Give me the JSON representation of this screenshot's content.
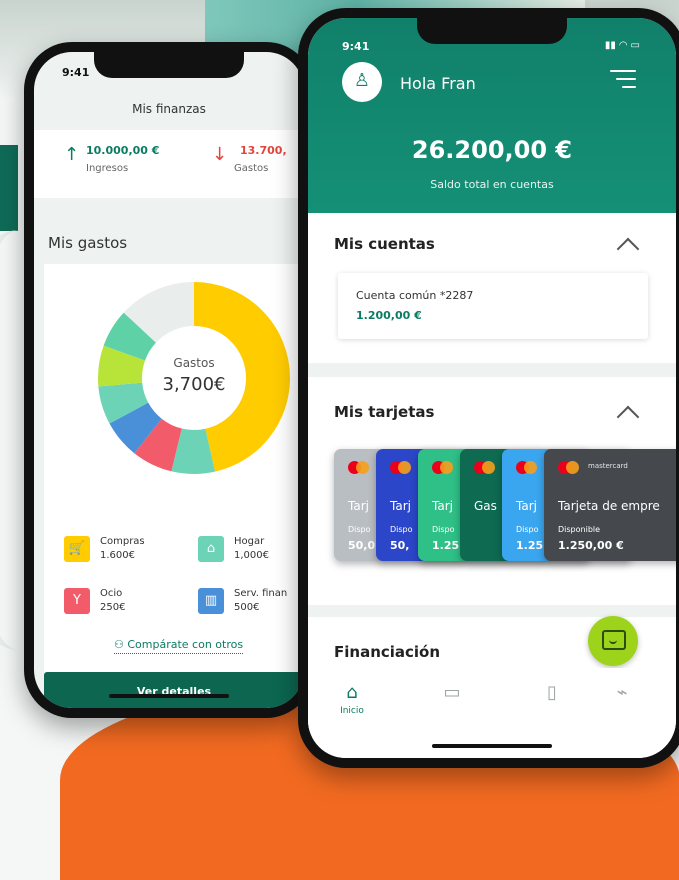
{
  "left_phone": {
    "status_time": "9:41",
    "title": "Mis finanzas",
    "summary": {
      "income_amount": "10.000,00 €",
      "income_label": "Ingresos",
      "expense_amount": "13.700,",
      "expense_label": "Gastos"
    },
    "expenses_title": "Mis gastos",
    "donut": {
      "center_label": "Gastos",
      "center_value": "3,700€"
    },
    "legend": [
      {
        "name": "Compras",
        "value": "1.600€",
        "color": "#ffcc00",
        "icon": "cart-icon"
      },
      {
        "name": "Hogar",
        "value": "1,000€",
        "color": "#6dd3b6",
        "icon": "home-icon"
      },
      {
        "name": "Ocio",
        "value": "250€",
        "color": "#f25c6a",
        "icon": "cocktail-icon"
      },
      {
        "name": "Serv. finan",
        "value": "500€",
        "color": "#4a90d9",
        "icon": "bank-icon"
      }
    ],
    "compare_label": "Compárate con otros",
    "details_button": "Ver detalles"
  },
  "right_phone": {
    "status_time": "9:41",
    "greeting": "Hola Fran",
    "total_balance": "26.200,00 €",
    "total_label": "Saldo total en cuentas",
    "accounts_title": "Mis cuentas",
    "account": {
      "name": "Cuenta común *2287",
      "balance": "1.200,00 €"
    },
    "cards_title": "Mis tarjetas",
    "cards": [
      {
        "name": "Tarj",
        "label": "Dispo",
        "amount": "50,0",
        "color": "#b9bec2"
      },
      {
        "name": "Tarj",
        "label": "Dispo",
        "amount": "50,",
        "color": "#2c46c9"
      },
      {
        "name": "Tarj",
        "label": "Dispo",
        "amount": "1.25",
        "color": "#2fc087"
      },
      {
        "name": "Gas",
        "label": "",
        "amount": "",
        "color": "#0e6b52"
      },
      {
        "name": "Tarj",
        "label": "Dispo",
        "amount": "1.25",
        "color": "#3aa6f0"
      },
      {
        "name": "Tarjeta de empre",
        "label": "Disponible",
        "amount": "1.250,00 €",
        "color": "#45494d",
        "brand": "mastercard"
      }
    ],
    "financing_title": "Financiación",
    "tabs": [
      {
        "icon": "home-icon",
        "label": "Inicio"
      },
      {
        "icon": "wallet-icon",
        "label": ""
      },
      {
        "icon": "card-icon",
        "label": ""
      },
      {
        "icon": "tag-icon",
        "label": ""
      }
    ]
  },
  "colors": {
    "brand_green": "#11806a",
    "accent_lime": "#9dd31b",
    "expense_red": "#e0463c"
  }
}
